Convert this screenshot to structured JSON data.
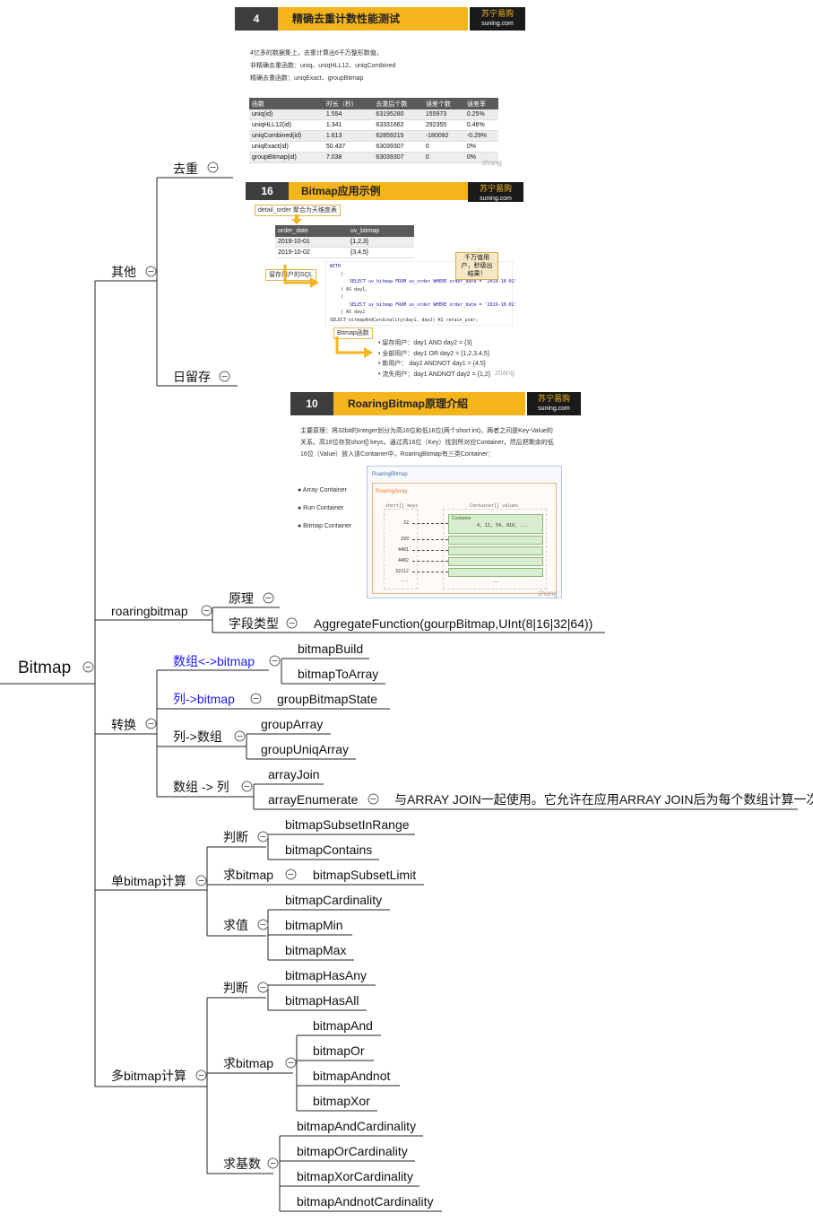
{
  "root": "Bitmap",
  "branches": {
    "other": {
      "label": "其他",
      "dedup": "去重",
      "retention": "日留存"
    },
    "roaring": {
      "label": "roaringbitmap",
      "principle": "原理",
      "field_type": "字段类型",
      "aggregate_function": "AggregateFunction(gourpBitmap,UInt(8|16|32|64))"
    },
    "convert": {
      "label": "转换",
      "array_to_bitmap": "数组<->bitmap",
      "bitmap_build": "bitmapBuild",
      "bitmap_to_array": "bitmapToArray",
      "column_to_bitmap": "列->bitmap",
      "group_bitmap_state": "groupBitmapState",
      "column_to_array": "列->数组",
      "group_array": "groupArray",
      "group_uniq_array": "groupUniqArray",
      "array_to_column": "数组 -> 列",
      "array_join": "arrayJoin",
      "array_enumerate": "arrayEnumerate",
      "array_enumerate_note": "与ARRAY JOIN一起使用。它允许在应用ARRAY JOIN后为每个数组计算一次"
    },
    "single": {
      "label": "单bitmap计算",
      "judge": "判断",
      "subset_in_range": "bitmapSubsetInRange",
      "contains": "bitmapContains",
      "get_bitmap": "求bitmap",
      "subset_limit": "bitmapSubsetLimit",
      "get_value": "求值",
      "cardinality": "bitmapCardinality",
      "min": "bitmapMin",
      "max": "bitmapMax"
    },
    "multi": {
      "label": "多bitmap计算",
      "judge": "判断",
      "has_any": "bitmapHasAny",
      "has_all": "bitmapHasAll",
      "get_bitmap": "求bitmap",
      "and": "bitmapAnd",
      "or": "bitmapOr",
      "andnot": "bitmapAndnot",
      "xor": "bitmapXor",
      "get_cardinality": "求基数",
      "and_card": "bitmapAndCardinality",
      "or_card": "bitmapOrCardinality",
      "xor_card": "bitmapXorCardinality",
      "andnot_card": "bitmapAndnotCardinality"
    }
  },
  "cards": {
    "perf": {
      "number": "4",
      "title": "精确去重计数性能测试",
      "logo": "苏宁易购",
      "logo_sub": "suning.com",
      "line1": "4亿多的数据集上，去重计算出6千万整形数值，",
      "line2": "非精确去重函数：uniq、uniqHLL12、uniqCombined",
      "line3": "精确去重函数：uniqExact、groupBitmap",
      "headers": [
        "函数",
        "时长（秒）",
        "去重后个数",
        "误差个数",
        "误差率"
      ],
      "rows": [
        [
          "uniq(id)",
          "1.554",
          "63195280",
          "155973",
          "0.25%"
        ],
        [
          "uniqHLL12(id)",
          "1.341",
          "63331662",
          "292355",
          "0.46%"
        ],
        [
          "uniqCombined(id)",
          "1.613",
          "62859215",
          "-180092",
          "-0.29%"
        ],
        [
          "uniqExact(id)",
          "50.437",
          "63039307",
          "0",
          "0%"
        ],
        [
          "groupBitmap(id)",
          "7.038",
          "63039307",
          "0",
          "0%"
        ]
      ],
      "watermark": "zhang"
    },
    "retention": {
      "number": "16",
      "title": "Bitmap应用示例",
      "logo": "苏宁易购",
      "logo_sub": "suning.com",
      "source_label": "detail_order 聚合为天维度表",
      "headers": [
        "order_date",
        "uv_bitmap"
      ],
      "rows": [
        [
          "2019-10-01",
          "{1,2,3}"
        ],
        [
          "2019-10-02",
          "{3,4,5}"
        ]
      ],
      "sql_label": "留存用户的SQL",
      "callout": "千万值用户，秒级出结果！",
      "code": [
        [
          "kw",
          "WITH"
        ],
        [
          "pl",
          "("
        ],
        [
          "code1",
          "SELECT uv_bitmap FROM uv_order WHERE order_date = '2019-10-01'"
        ],
        [
          "pl",
          ") AS day1,"
        ],
        [
          "pl",
          "("
        ],
        [
          "code2",
          "SELECT uv_bitmap FROM uv_order WHERE order_date = '2019-10-02'"
        ],
        [
          "pl",
          ") AS day2"
        ],
        [
          "pl",
          "SELECT bitmapAndCardinality(day1, day2) AS retain_user;"
        ]
      ],
      "func_label": "Bitmap函数",
      "bullets": [
        "留存用户：day1  AND  day2  = {3}",
        "全部用户：day1  OR  day2 = {1,2,3,4,5}",
        "新用户：  day2  ANDNOT  day1  = {4,5}",
        "流失用户：day1  ANDNOT  day2 = {1,2}"
      ],
      "watermark": "zhang"
    },
    "roaring": {
      "number": "10",
      "title": "RoaringBitmap原理介绍",
      "logo": "苏宁易购",
      "logo_sub": "suning.com",
      "para1": "主要原理：将32bit的Integer划分为高16位和低16位(两个short int)，两者之间是Key-Value的",
      "para2": "关系。高16位存到short[] keys，通过高16位（Key）找到所对应Container，然后把剩余的低",
      "para3": "16位（Value）放入该Container中，RoaringBitmap有三类Container：",
      "containers": [
        "Array Container",
        "Run Container",
        "Bitmap Container"
      ],
      "outer_label": "RoaringBitmap",
      "inner_label": "RoaringArray",
      "keys_label": "short[] keys",
      "values_label": "Container[] values",
      "container_label": "Container",
      "container_values": "4, 11, 54, 810, ...",
      "keys": [
        "32",
        "299",
        "4481",
        "4482",
        "32212",
        "..."
      ],
      "watermark": "zhang"
    }
  }
}
